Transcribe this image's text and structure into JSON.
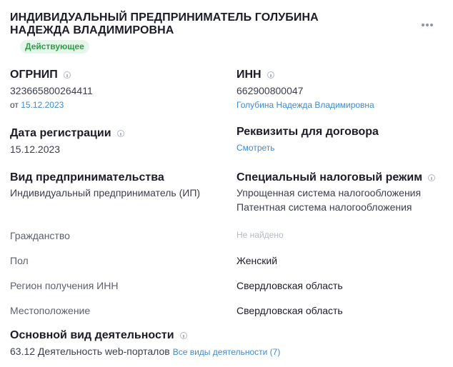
{
  "header": {
    "title": "ИНДИВИДУАЛЬНЫЙ ПРЕДПРИНИМАТЕЛЬ ГОЛУБИНА НАДЕЖДА ВЛАДИМИРОВНА",
    "status": "Действующее",
    "menu_icon": "more-dots-icon"
  },
  "ogrnip": {
    "heading": "ОГРНИП",
    "value": "323665800264411",
    "date_prefix": "от",
    "date": "15.12.2023"
  },
  "inn": {
    "heading": "ИНН",
    "value": "662900800047",
    "owner_link": "Голубина Надежда Владимировна"
  },
  "registration": {
    "heading": "Дата регистрации",
    "value": "15.12.2023"
  },
  "requisites": {
    "heading": "Реквизиты для договора",
    "link": "Смотреть"
  },
  "entrepreneurship": {
    "heading": "Вид предпринимательства",
    "value": "Индивидуальный предприниматель (ИП)"
  },
  "tax_regime": {
    "heading": "Специальный налоговый режим",
    "values": [
      "Упрощенная система налогообложения",
      "Патентная система налогообложения"
    ]
  },
  "details": [
    {
      "label": "Гражданство",
      "value": "Не найдено",
      "empty": true
    },
    {
      "label": "Пол",
      "value": "Женский",
      "empty": false
    },
    {
      "label": "Регион получения ИНН",
      "value": "Свердловская область",
      "empty": false
    },
    {
      "label": "Местоположение",
      "value": "Свердловская область",
      "empty": false
    }
  ],
  "activity": {
    "heading": "Основной вид деятельности",
    "value": "63.12 Деятельность web-порталов",
    "all_link": "Все виды деятельности (7)"
  },
  "colors": {
    "status_green": "#2c9c45",
    "status_bg": "#e7f6ea",
    "link_blue": "#3d8ad6"
  }
}
